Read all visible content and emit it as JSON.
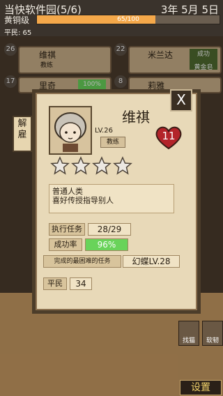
{
  "header": {
    "title": "当快软件园(5/6)",
    "date": "3年 5月 5日",
    "rank": "黄铜级",
    "xp_text": "65/100",
    "xp_progress": 0.65,
    "gold": "平民: 65"
  },
  "roster": [
    {
      "level": "26",
      "name": "维祺",
      "job": "教练"
    },
    {
      "level": "22",
      "name": "米兰达",
      "status": "成功",
      "sub": "黄金皂"
    },
    {
      "level": "17",
      "name": "里奇",
      "progress_text": "100%"
    },
    {
      "level": "8",
      "name": "莉雅"
    }
  ],
  "dialog": {
    "fire_button": "解雇",
    "close_button": "X",
    "name": "维祺",
    "level": "LV.26",
    "job": "教练",
    "heart_value": "11",
    "stars_filled": 4,
    "description_line1": "普通人类",
    "description_line2": "喜好传授指导别人",
    "stats": [
      {
        "label": "执行任务",
        "value": "28/29"
      },
      {
        "label": "成功率",
        "value": "96%"
      },
      {
        "label": "完成的最困难的任务",
        "value": "幻蝶LV.28"
      },
      {
        "label": "平民",
        "value": "34"
      }
    ]
  },
  "bottom": {
    "settings_button": "设置",
    "btn_1": "找猫",
    "btn_2": "软韧"
  },
  "colors": {
    "xp_fill": "#f4a84a",
    "success_rate_bg": "#69d35a",
    "dialog_bg": "#e8d9b8",
    "settings_text": "#f3d36b"
  }
}
